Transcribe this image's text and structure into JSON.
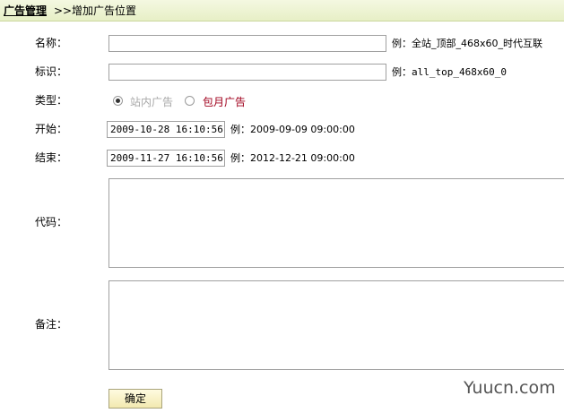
{
  "breadcrumb": {
    "root": "广告管理",
    "separator": ">>",
    "current": "增加广告位置"
  },
  "form": {
    "name": {
      "label": "名称：",
      "value": "",
      "hint": "例：全站_顶部_468x60_时代互联"
    },
    "ident": {
      "label": "标识：",
      "value": "",
      "hint": "例：all_top_468x60_0"
    },
    "type": {
      "label": "类型：",
      "options": [
        {
          "label": "站内广告",
          "checked": true
        },
        {
          "label": "包月广告",
          "checked": false
        }
      ]
    },
    "start": {
      "label": "开始：",
      "value": "2009-10-28 16:10:56",
      "hint": "例：2009-09-09 09:00:00"
    },
    "end": {
      "label": "结束：",
      "value": "2009-11-27 16:10:56",
      "hint": "例：2012-12-21 09:00:00"
    },
    "code": {
      "label": "代码：",
      "value": ""
    },
    "note": {
      "label": "备注：",
      "value": ""
    },
    "submit_label": "确定"
  },
  "colors": {
    "header_bg": "#e7efc6",
    "option_disabled": "#a8a8a8",
    "option_highlight": "#a0001c"
  },
  "watermark": "Yuucn.com"
}
